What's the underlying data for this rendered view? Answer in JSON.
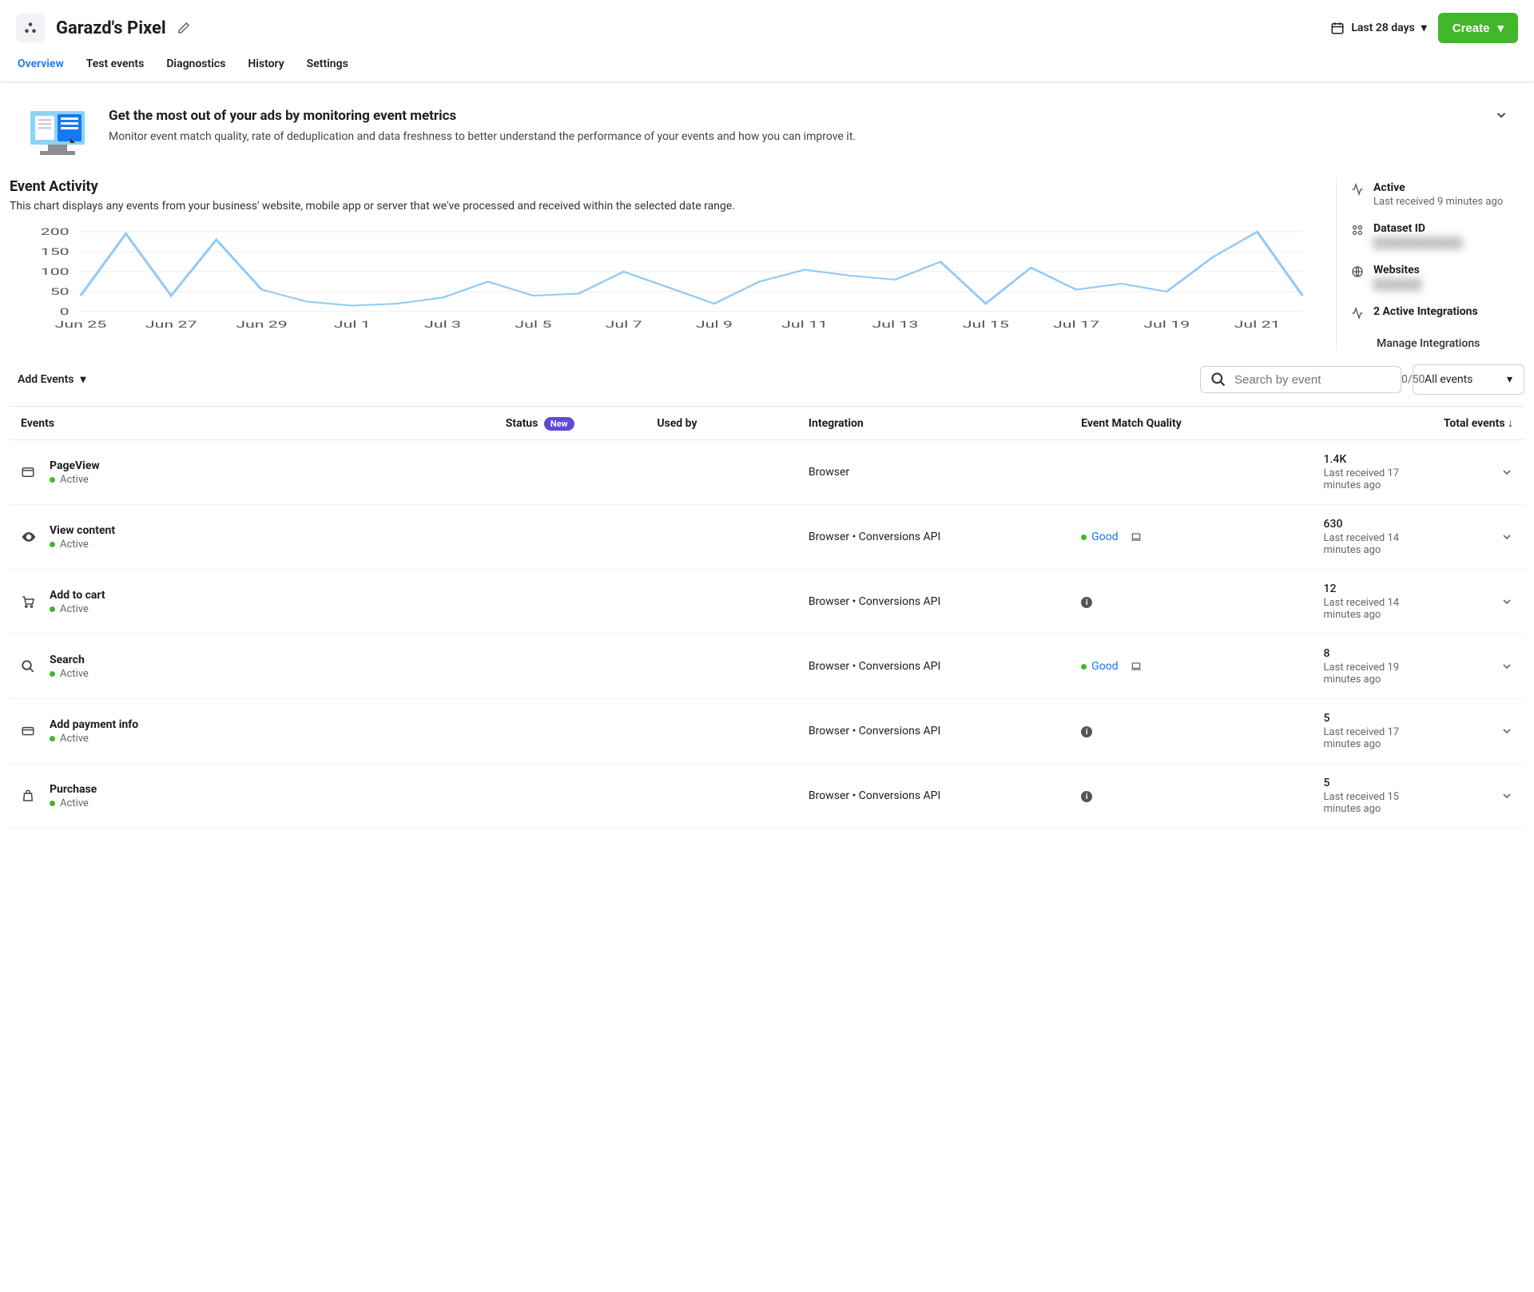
{
  "header": {
    "title": "Garazd's Pixel",
    "date_range": "Last 28 days",
    "create_label": "Create"
  },
  "tabs": [
    "Overview",
    "Test events",
    "Diagnostics",
    "History",
    "Settings"
  ],
  "active_tab_index": 0,
  "banner": {
    "title": "Get the most out of your ads by monitoring event metrics",
    "subtitle": "Monitor event match quality, rate of deduplication and data freshness to better understand the performance of your events and how you can improve it."
  },
  "activity": {
    "title": "Event Activity",
    "subtitle": "This chart displays any events from your business' website, mobile app or server that we've processed and received within the selected date range."
  },
  "chart_data": {
    "type": "line",
    "x": [
      "Jun 25",
      "Jun 26",
      "Jun 27",
      "Jun 28",
      "Jun 29",
      "Jun 30",
      "Jul 1",
      "Jul 2",
      "Jul 3",
      "Jul 4",
      "Jul 5",
      "Jul 6",
      "Jul 7",
      "Jul 8",
      "Jul 9",
      "Jul 10",
      "Jul 11",
      "Jul 12",
      "Jul 13",
      "Jul 14",
      "Jul 15",
      "Jul 16",
      "Jul 17",
      "Jul 18",
      "Jul 19",
      "Jul 20",
      "Jul 21",
      "Jul 22"
    ],
    "x_ticks": [
      "Jun 25",
      "Jun 27",
      "Jun 29",
      "Jul 1",
      "Jul 3",
      "Jul 5",
      "Jul 7",
      "Jul 9",
      "Jul 11",
      "Jul 13",
      "Jul 15",
      "Jul 17",
      "Jul 19",
      "Jul 21"
    ],
    "y_ticks": [
      0,
      50,
      100,
      150,
      200
    ],
    "values": [
      40,
      195,
      40,
      180,
      55,
      25,
      15,
      20,
      35,
      75,
      40,
      45,
      100,
      60,
      20,
      75,
      105,
      90,
      80,
      125,
      20,
      110,
      55,
      70,
      50,
      135,
      200,
      40
    ],
    "ylim": [
      0,
      200
    ],
    "xlabel": "",
    "ylabel": "",
    "series_color": "#90caf9"
  },
  "side": {
    "active_label": "Active",
    "active_sub": "Last received 9 minutes ago",
    "dataset_label": "Dataset ID",
    "dataset_value": "███████████",
    "websites_label": "Websites",
    "websites_value": "██████",
    "integrations_label": "2 Active Integrations",
    "manage_link": "Manage Integrations"
  },
  "table_controls": {
    "add_events": "Add Events",
    "search_placeholder": "Search by event",
    "search_count": "0/50",
    "filter": "All events"
  },
  "columns": {
    "events": "Events",
    "status": "Status",
    "status_badge": "New",
    "used_by": "Used by",
    "integration": "Integration",
    "quality": "Event Match Quality",
    "total": "Total events"
  },
  "rows": [
    {
      "icon": "window",
      "name": "PageView",
      "status": "Active",
      "integration": "Browser",
      "quality": null,
      "total": "1.4K",
      "sub": "Last received 17 minutes ago"
    },
    {
      "icon": "eye",
      "name": "View content",
      "status": "Active",
      "integration": "Browser • Conversions API",
      "quality": "Good",
      "quality_icon": "laptop",
      "total": "630",
      "sub": "Last received 14 minutes ago"
    },
    {
      "icon": "cart",
      "name": "Add to cart",
      "status": "Active",
      "integration": "Browser • Conversions API",
      "quality": "info",
      "total": "12",
      "sub": "Last received 14 minutes ago"
    },
    {
      "icon": "search",
      "name": "Search",
      "status": "Active",
      "integration": "Browser • Conversions API",
      "quality": "Good",
      "quality_icon": "laptop",
      "total": "8",
      "sub": "Last received 19 minutes ago"
    },
    {
      "icon": "card",
      "name": "Add payment info",
      "status": "Active",
      "integration": "Browser • Conversions API",
      "quality": "info",
      "total": "5",
      "sub": "Last received 17 minutes ago"
    },
    {
      "icon": "bag",
      "name": "Purchase",
      "status": "Active",
      "integration": "Browser • Conversions API",
      "quality": "info",
      "total": "5",
      "sub": "Last received 15 minutes ago"
    }
  ]
}
